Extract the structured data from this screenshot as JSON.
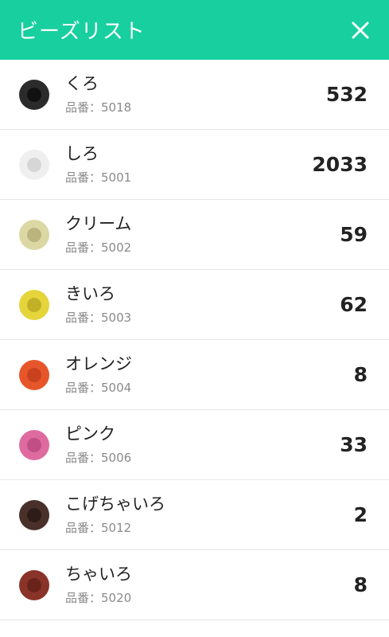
{
  "header": {
    "title": "ビーズリスト",
    "close_icon": "close-icon"
  },
  "colors": {
    "header_bg": "#17cf9f"
  },
  "beads": [
    {
      "name": "くろ",
      "code": "品番：5018",
      "count": "532",
      "outer": "#2b2b2b",
      "inner": "#111111"
    },
    {
      "name": "しろ",
      "code": "品番：5001",
      "count": "2033",
      "outer": "#efefef",
      "inner": "#d6d6d6"
    },
    {
      "name": "クリーム",
      "code": "品番：5002",
      "count": "59",
      "outer": "#dcd8a4",
      "inner": "#bab57f"
    },
    {
      "name": "きいろ",
      "code": "品番：5003",
      "count": "62",
      "outer": "#e5d43a",
      "inner": "#c2b126"
    },
    {
      "name": "オレンジ",
      "code": "品番：5004",
      "count": "8",
      "outer": "#e7552b",
      "inner": "#c9411d"
    },
    {
      "name": "ピンク",
      "code": "品番：5006",
      "count": "33",
      "outer": "#df6aa0",
      "inner": "#bf4f84"
    },
    {
      "name": "こげちゃいろ",
      "code": "品番：5012",
      "count": "2",
      "outer": "#4a302b",
      "inner": "#2e1c19"
    },
    {
      "name": "ちゃいろ",
      "code": "品番：5020",
      "count": "8",
      "outer": "#8a3328",
      "inner": "#6a231b"
    }
  ]
}
